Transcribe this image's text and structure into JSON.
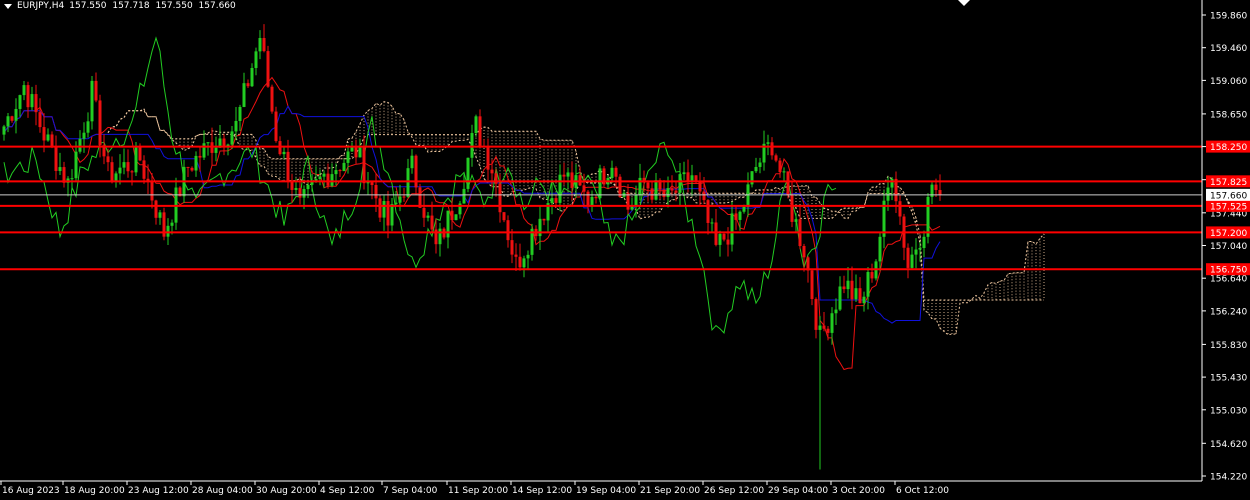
{
  "header": {
    "symbol": "EURJPY,H4",
    "open": "157.550",
    "high": "157.718",
    "low": "157.550",
    "close": "157.660"
  },
  "colors": {
    "background": "#000000",
    "bull": "#22cc22",
    "bear": "#ee1111",
    "tenkan": "#ee1111",
    "kijun": "#1111dd",
    "chikou": "#22cc22",
    "cloud": "#f0c8a0",
    "level": "#ff0000",
    "axis_text": "#ffffff",
    "price_box_bg": "#ffffff"
  },
  "chart_data": {
    "type": "candlestick",
    "instrument": "EURJPY",
    "timeframe": "H4",
    "ylim": [
      154.2,
      160.0
    ],
    "yticks": [
      "159.860",
      "159.460",
      "159.060",
      "158.650",
      "158.250",
      "157.845",
      "157.440",
      "157.040",
      "156.640",
      "156.240",
      "155.830",
      "155.430",
      "155.030",
      "154.620",
      "154.220"
    ],
    "xticks": [
      "16 Aug 2023",
      "18 Aug 20:00",
      "23 Aug 12:00",
      "28 Aug 04:00",
      "30 Aug 20:00",
      "4 Sep 12:00",
      "7 Sep 04:00",
      "11 Sep 20:00",
      "14 Sep 12:00",
      "19 Sep 04:00",
      "21 Sep 20:00",
      "26 Sep 12:00",
      "29 Sep 04:00",
      "3 Oct 20:00",
      "6 Oct 12:00"
    ],
    "levels": [
      {
        "price": 158.25,
        "label": "158.250"
      },
      {
        "price": 157.825,
        "label": "157.825"
      },
      {
        "price": 157.525,
        "label": "157.525"
      },
      {
        "price": 157.2,
        "label": "157.200"
      },
      {
        "price": 156.75,
        "label": "156.750"
      }
    ],
    "current_price": {
      "price": 157.66,
      "label": "157.660"
    },
    "anchors": [
      [
        0,
        158.5
      ],
      [
        5,
        159.0
      ],
      [
        10,
        158.4
      ],
      [
        16,
        157.8
      ],
      [
        22,
        158.9
      ],
      [
        26,
        157.9
      ],
      [
        34,
        158.1
      ],
      [
        40,
        157.2
      ],
      [
        46,
        158.0
      ],
      [
        52,
        158.3
      ],
      [
        58,
        158.5
      ],
      [
        64,
        159.6
      ],
      [
        68,
        158.4
      ],
      [
        74,
        157.5
      ],
      [
        80,
        157.9
      ],
      [
        88,
        158.2
      ],
      [
        96,
        157.3
      ],
      [
        102,
        158.0
      ],
      [
        108,
        157.0
      ],
      [
        114,
        157.7
      ],
      [
        118,
        158.5
      ],
      [
        122,
        158.0
      ],
      [
        128,
        156.8
      ],
      [
        134,
        157.4
      ],
      [
        140,
        157.9
      ],
      [
        146,
        157.6
      ],
      [
        152,
        158.1
      ],
      [
        156,
        157.5
      ],
      [
        160,
        157.8
      ],
      [
        166,
        157.6
      ],
      [
        172,
        157.9
      ],
      [
        178,
        157.0
      ],
      [
        184,
        157.4
      ],
      [
        188,
        158.0
      ],
      [
        192,
        158.3
      ],
      [
        196,
        157.6
      ],
      [
        200,
        157.0
      ],
      [
        204,
        155.9
      ],
      [
        210,
        156.6
      ],
      [
        214,
        156.3
      ],
      [
        218,
        156.9
      ],
      [
        222,
        158.0
      ],
      [
        226,
        156.8
      ],
      [
        230,
        157.3
      ],
      [
        232,
        157.8
      ],
      [
        234,
        157.6
      ]
    ]
  }
}
